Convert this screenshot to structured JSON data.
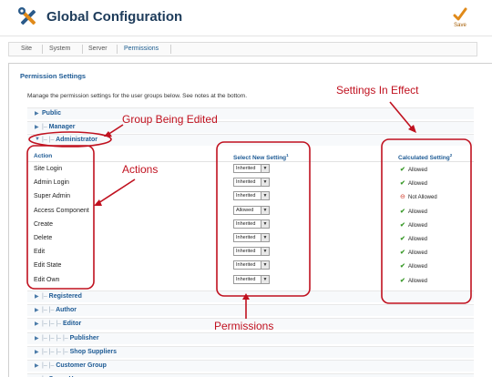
{
  "header": {
    "title": "Global Configuration",
    "save_label": "Save"
  },
  "tabs": [
    {
      "label": "Site"
    },
    {
      "label": "System"
    },
    {
      "label": "Server"
    },
    {
      "label": "Permissions",
      "active": true
    }
  ],
  "panel": {
    "title": "Permission Settings",
    "description": "Manage the permission settings for the user groups below. See notes at the bottom."
  },
  "groups_top": [
    {
      "prefix": "",
      "name": "Public",
      "arrow": "▶"
    },
    {
      "prefix": "|–",
      "name": "Manager",
      "arrow": "▶"
    },
    {
      "prefix": "|– |–",
      "name": "Administrator",
      "arrow": "▼"
    }
  ],
  "table": {
    "col_action": "Action",
    "col_select": "Select New Setting",
    "col_select_note": "1",
    "col_calc": "Calculated Setting",
    "col_calc_note": "2",
    "rows": [
      {
        "action": "Site Login",
        "setting": "Inherited",
        "calculated": "Allowed",
        "status": "allowed"
      },
      {
        "action": "Admin Login",
        "setting": "Inherited",
        "calculated": "Allowed",
        "status": "allowed"
      },
      {
        "action": "Super Admin",
        "setting": "Inherited",
        "calculated": "Not Allowed",
        "status": "not-allowed"
      },
      {
        "action": "Access Component",
        "setting": "Allowed",
        "calculated": "Allowed",
        "status": "allowed"
      },
      {
        "action": "Create",
        "setting": "Inherited",
        "calculated": "Allowed",
        "status": "allowed"
      },
      {
        "action": "Delete",
        "setting": "Inherited",
        "calculated": "Allowed",
        "status": "allowed"
      },
      {
        "action": "Edit",
        "setting": "Inherited",
        "calculated": "Allowed",
        "status": "allowed"
      },
      {
        "action": "Edit State",
        "setting": "Inherited",
        "calculated": "Allowed",
        "status": "allowed"
      },
      {
        "action": "Edit Own",
        "setting": "Inherited",
        "calculated": "Allowed",
        "status": "allowed"
      }
    ]
  },
  "groups_bottom": [
    {
      "prefix": "|–",
      "name": "Registered",
      "arrow": "▶"
    },
    {
      "prefix": "|– |–",
      "name": "Author",
      "arrow": "▶"
    },
    {
      "prefix": "|– |– |–",
      "name": "Editor",
      "arrow": "▶"
    },
    {
      "prefix": "|– |– |– |–",
      "name": "Publisher",
      "arrow": "▶"
    },
    {
      "prefix": "|– |– |– |–",
      "name": "Shop Suppliers",
      "arrow": "▶"
    },
    {
      "prefix": "|– |–",
      "name": "Customer Group",
      "arrow": "▶"
    },
    {
      "prefix": "|–",
      "name": "Super Users",
      "arrow": "▶"
    }
  ],
  "annotations": {
    "group_edited": "Group Being Edited",
    "settings_in_effect": "Settings In Effect",
    "actions": "Actions",
    "permissions": "Permissions"
  },
  "colors": {
    "annotation": "#c0111f",
    "link": "#1d5a94",
    "allowed": "#3a9a2a",
    "not_allowed": "#d03a2a"
  }
}
